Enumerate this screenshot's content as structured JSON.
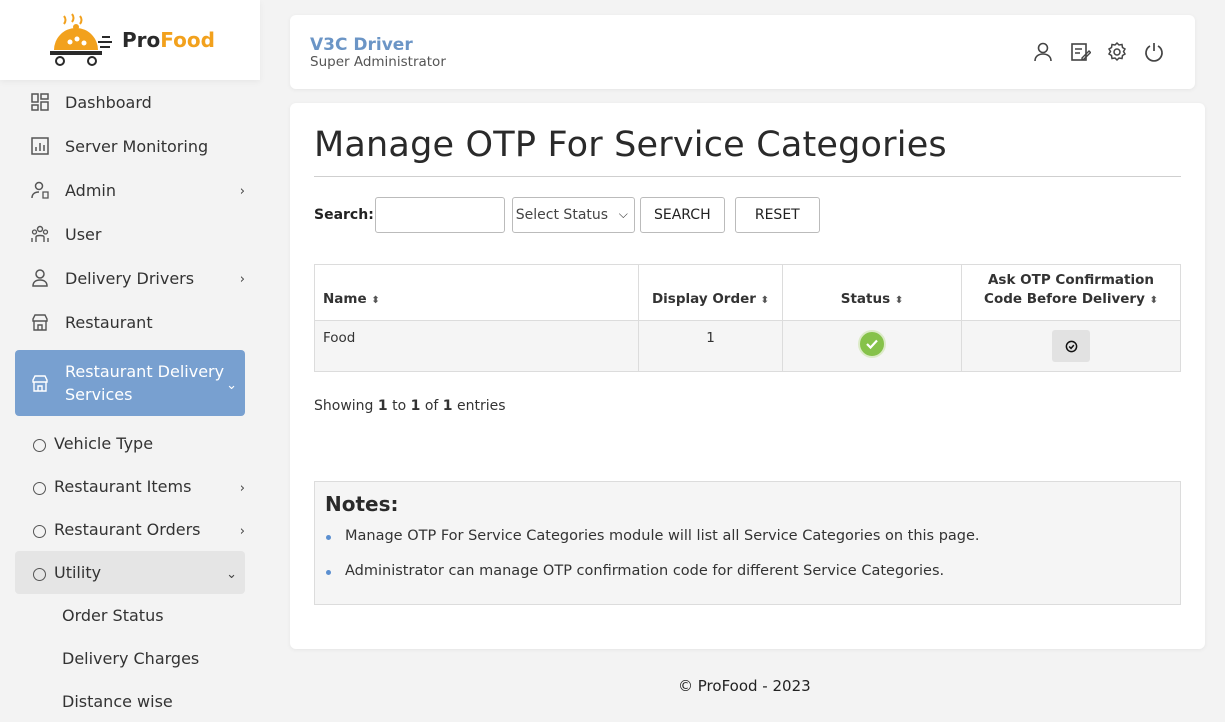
{
  "logo": {
    "part1": "Pro",
    "part2": "Food"
  },
  "sidebar": {
    "items": [
      {
        "label": "Dashboard"
      },
      {
        "label": "Server Monitoring"
      },
      {
        "label": "Admin"
      },
      {
        "label": "User"
      },
      {
        "label": "Delivery Drivers"
      },
      {
        "label": "Restaurant"
      },
      {
        "label": "Restaurant Delivery Services"
      }
    ],
    "subitems": [
      {
        "label": "Vehicle Type"
      },
      {
        "label": "Restaurant Items"
      },
      {
        "label": "Restaurant Orders"
      },
      {
        "label": "Utility"
      }
    ],
    "utility_children": [
      {
        "label": "Order Status"
      },
      {
        "label": "Delivery Charges"
      },
      {
        "label": "Distance wise"
      }
    ]
  },
  "header": {
    "user_name": "V3C Driver",
    "user_role": "Super Administrator"
  },
  "page": {
    "title": "Manage OTP For Service Categories"
  },
  "search": {
    "label": "Search:",
    "input_value": "",
    "status_selected": "Select Status",
    "search_btn": "SEARCH",
    "reset_btn": "RESET"
  },
  "table": {
    "headers": {
      "name": "Name",
      "display_order": "Display Order",
      "status": "Status",
      "ask_otp": "Ask OTP Confirmation Code Before Delivery"
    },
    "rows": [
      {
        "name": "Food",
        "display_order": "1"
      }
    ]
  },
  "showing": {
    "prefix": "Showing",
    "from": "1",
    "to_word": "to",
    "to": "1",
    "of_word": "of",
    "total": "1",
    "suffix": "entries"
  },
  "notes": {
    "title": "Notes:",
    "items": [
      "Manage OTP For Service Categories module will list all Service Categories on this page.",
      "Administrator can manage OTP confirmation code for different Service Categories."
    ]
  },
  "footer": {
    "text": "© ProFood - 2023"
  },
  "colors": {
    "accent": "#78a0d0",
    "brand_orange": "#f2a11d",
    "status_active": "#86c24a"
  }
}
